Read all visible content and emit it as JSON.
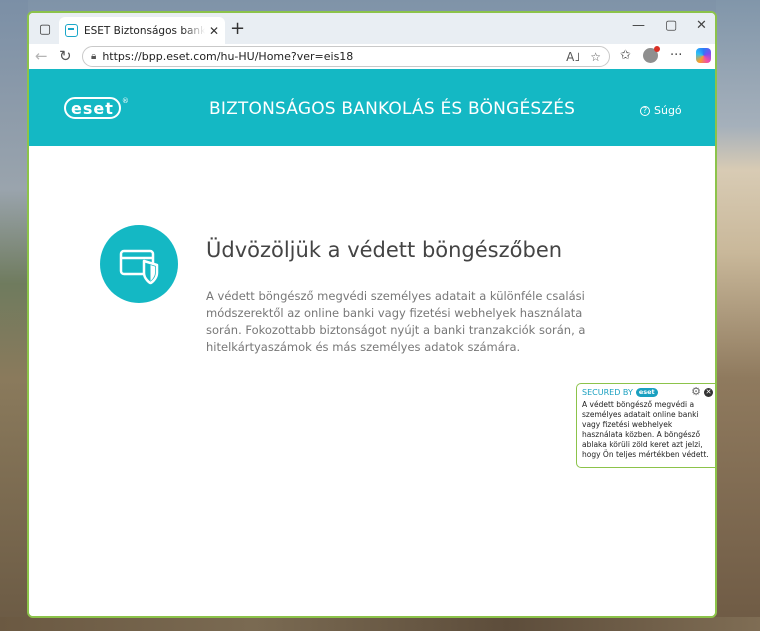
{
  "browser": {
    "tab_title": "ESET Biztonságos bankolás és bön",
    "new_tab": "+",
    "url": "https://bpp.eset.com/hu-HU/Home?ver=eis18",
    "read_aloud": "A˩"
  },
  "header": {
    "logo": "eset",
    "logo_reg": "®",
    "title": "BIZTONSÁGOS BANKOLÁS ÉS BÖNGÉSZÉS",
    "help_label": "Súgó",
    "help_symbol": "?"
  },
  "main": {
    "title": "Üdvözöljük a védett böngészőben",
    "description": "A védett böngésző megvédi személyes adatait a különféle csalási módszerektől az online banki vagy fizetési webhelyek használata során. Fokozottabb biztonságot nyújt a banki tranzakciók során, a hitelkártyaszámok és más személyes adatok számára."
  },
  "secured_badge": {
    "label": "SECURED BY",
    "logo": "eset",
    "text": "A védett böngésző megvédi a személyes adatait online banki vagy fizetési webhelyek használata közben. A böngésző ablaka körüli zöld keret azt jelzi, hogy Ön teljes mértékben védett."
  },
  "colors": {
    "accent": "#14b8c4",
    "frame": "#8cc34a"
  }
}
